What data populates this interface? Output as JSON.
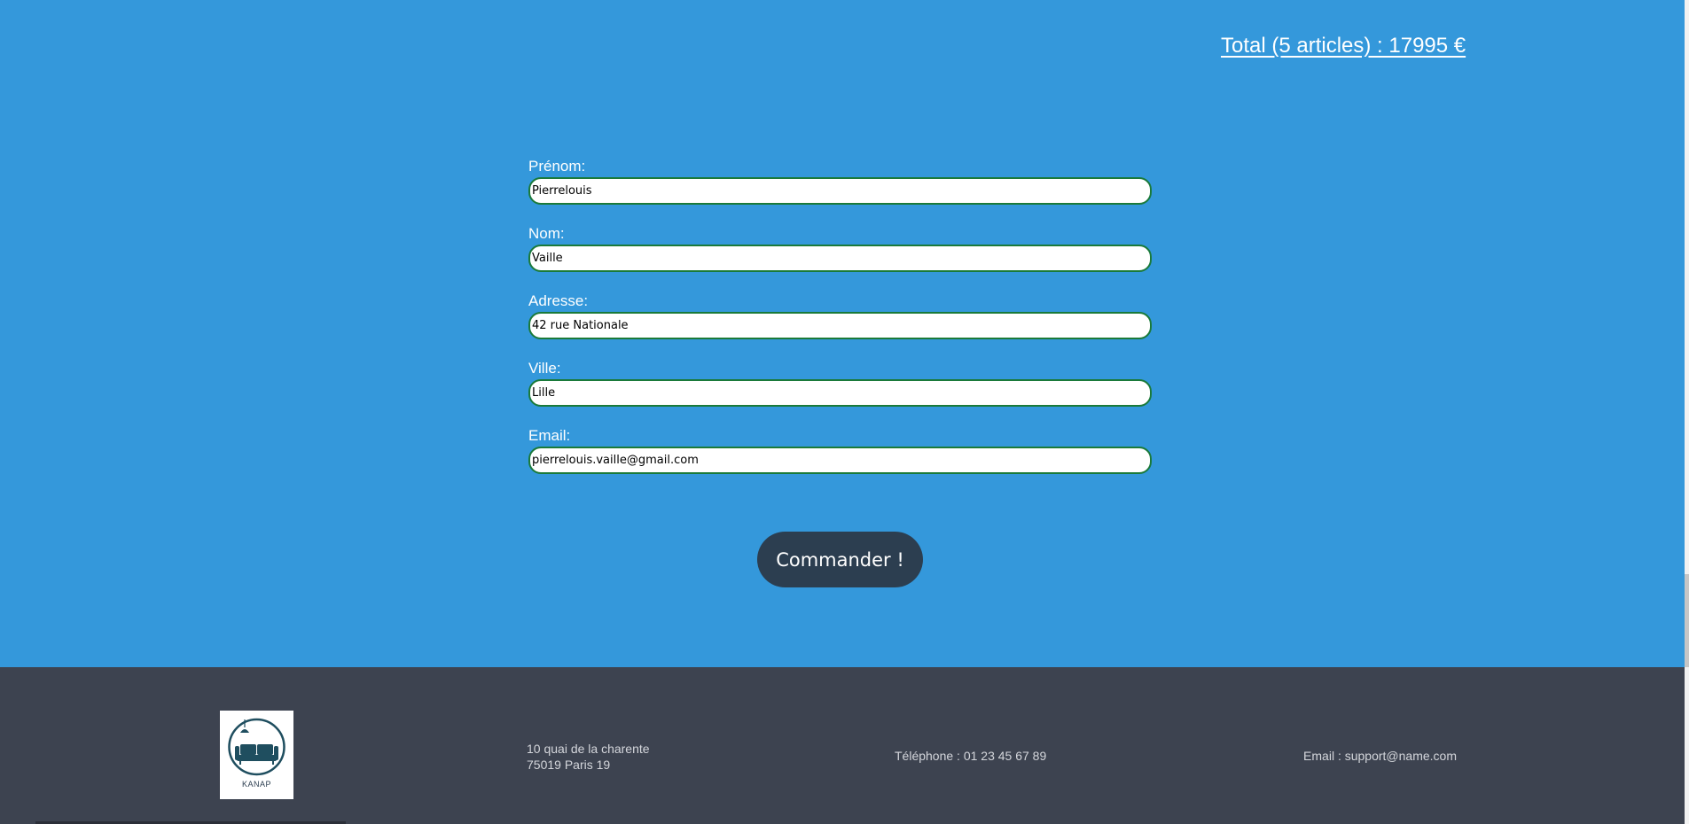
{
  "cart": {
    "total_label": "Total (5 articles) : 17995 €"
  },
  "form": {
    "fields": [
      {
        "label": "Prénom:",
        "value": "Pierrelouis"
      },
      {
        "label": "Nom:",
        "value": "Vaille"
      },
      {
        "label": "Adresse:",
        "value": "42 rue Nationale"
      },
      {
        "label": "Ville:",
        "value": "Lille"
      },
      {
        "label": "Email:",
        "value": "pierrelouis.vaille@gmail.com"
      }
    ],
    "submit_label": "Commander !"
  },
  "footer": {
    "logo_text": "KANAP",
    "address_line1": "10 quai de la charente",
    "address_line2": "75019 Paris 19",
    "phone": "Téléphone : 01 23 45 67 89",
    "email": "Email : support@name.com"
  },
  "colors": {
    "page_background": "#3498db",
    "footer_background": "#3d4350",
    "button_background": "#2c3e50",
    "input_border": "#1a7a3a"
  },
  "icons": {
    "logo": "sofa-lamp-icon"
  }
}
